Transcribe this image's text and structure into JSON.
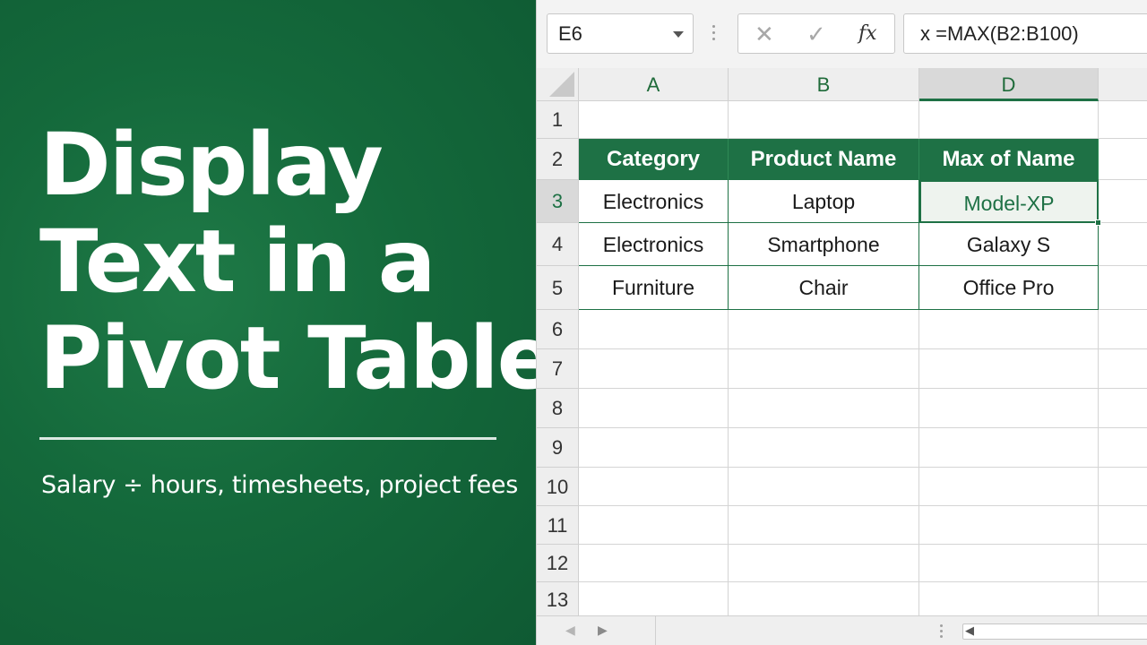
{
  "banner": {
    "headline_lines": [
      "Display",
      "Text in a",
      "Pivot Table"
    ],
    "subtitle": "Salary ÷ hours, timesheets, project fees"
  },
  "toolbar": {
    "name_box": "E6",
    "cancel_symbol": "✕",
    "enter_symbol": "✓",
    "fx_label": "fx",
    "formula": "x =MAX(B2:B100)"
  },
  "grid": {
    "columns": [
      "A",
      "B",
      "D"
    ],
    "selected_column": "D",
    "rows": [
      "1",
      "2",
      "3",
      "4",
      "5",
      "6",
      "7",
      "8",
      "9",
      "10",
      "11",
      "12",
      "13"
    ],
    "selected_row": "3",
    "pivot_headers": [
      "Category",
      "Product Name",
      "Max of Name"
    ],
    "pivot_rows": [
      [
        "Electronics",
        "Laptop",
        "Model-XP"
      ],
      [
        "Electronics",
        "Smartphone",
        "Galaxy S"
      ],
      [
        "Furniture",
        "Chair",
        "Office Pro"
      ]
    ]
  },
  "colors": {
    "banner_green": "#14693b",
    "pivot_header_green": "#1e7145",
    "active_cell_text": "#1e7145"
  },
  "icons": [
    "dropdown-arrow-icon",
    "cancel-icon",
    "checkmark-icon",
    "function-icon",
    "prev-sheet-icon",
    "next-sheet-icon",
    "scroll-left-icon"
  ]
}
